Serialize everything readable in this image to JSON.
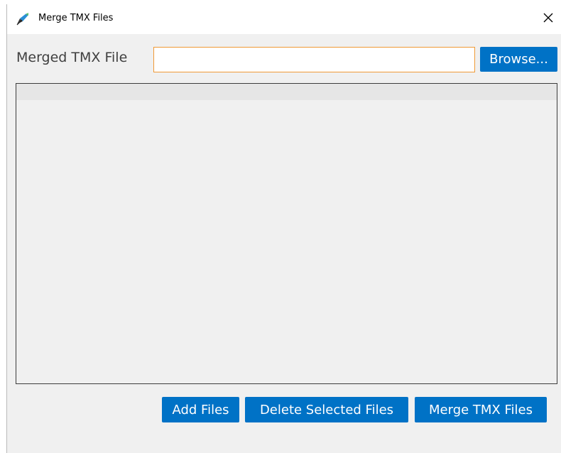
{
  "window": {
    "title": "Merge TMX Files",
    "icon": "feather-pen-icon",
    "close_icon": "close-icon"
  },
  "form": {
    "merged_file_label": "Merged TMX File",
    "merged_file_value": "",
    "browse_label": "Browse..."
  },
  "file_list": {
    "items": []
  },
  "actions": {
    "add_files_label": "Add Files",
    "delete_selected_label": "Delete Selected Files",
    "merge_label": "Merge TMX Files"
  },
  "colors": {
    "button_bg": "#0072c6",
    "input_focus_border": "#f09a36",
    "window_bg": "#f0f0f0"
  }
}
